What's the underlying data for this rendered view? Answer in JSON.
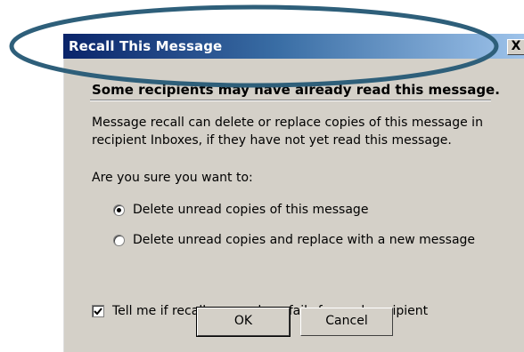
{
  "dialog": {
    "title": "Recall This Message",
    "close_glyph": "X",
    "heading": "Some recipients may have already read this message.",
    "description": "Message recall can delete or replace copies of this message in recipient Inboxes, if they have not yet read this message.",
    "question": "Are you sure you want to:",
    "options": [
      {
        "label": "Delete unread copies of this message",
        "selected": true
      },
      {
        "label": "Delete unread copies and replace with a new message",
        "selected": false
      }
    ],
    "notify": {
      "label": "Tell me if recall succeeds or fails for each recipient",
      "checked": true
    },
    "buttons": {
      "ok": "OK",
      "cancel": "Cancel"
    }
  },
  "annotation": {
    "shape": "ellipse",
    "color": "#2e5f7a"
  }
}
